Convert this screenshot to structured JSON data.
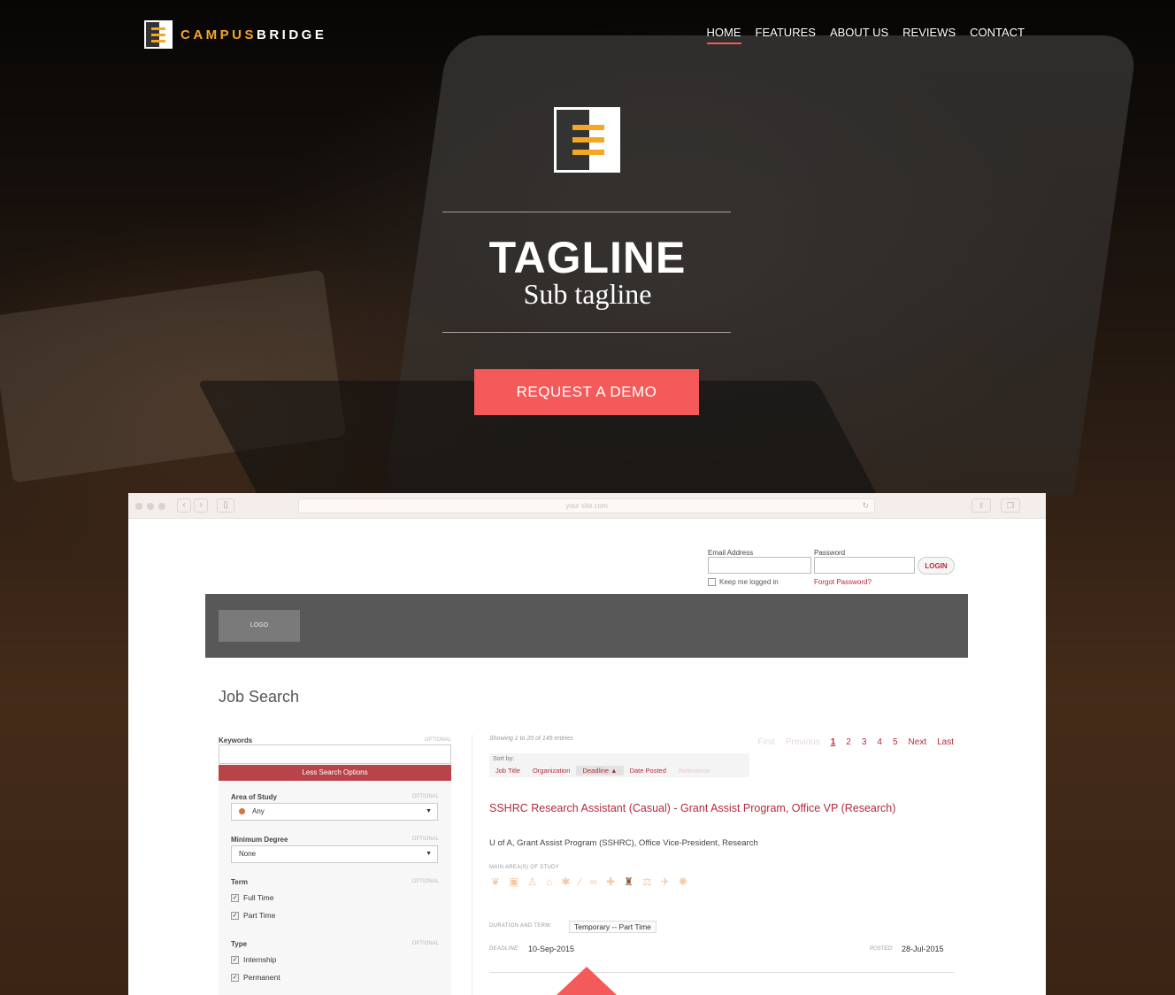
{
  "brand": {
    "campus": "CAMPUS",
    "bridge": "BRIDGE"
  },
  "nav": {
    "items": [
      {
        "label": "HOME",
        "active": true
      },
      {
        "label": "FEATURES"
      },
      {
        "label": "ABOUT US"
      },
      {
        "label": "REVIEWS"
      },
      {
        "label": "CONTACT"
      }
    ]
  },
  "hero": {
    "tagline": "TAGLINE",
    "subtagline": "Sub tagline",
    "cta": "REQUEST A DEMO"
  },
  "browser": {
    "url": "your site.com"
  },
  "mock": {
    "login": {
      "email_label": "Email Address",
      "password_label": "Password",
      "button": "LOGIN",
      "keep": "Keep me logged in",
      "forgot": "Forgot Password?"
    },
    "logo": "LOGO",
    "page_title": "Job Search",
    "search": {
      "keywords_label": "Keywords",
      "optional": "OPTIONAL",
      "less_options": "Less Search Options",
      "area_label": "Area of Study",
      "area_value": "Any",
      "degree_label": "Minimum Degree",
      "degree_value": "None",
      "term_label": "Term",
      "term_options": [
        "Full Time",
        "Part Time"
      ],
      "type_label": "Type",
      "type_options": [
        "Internship",
        "Permanent"
      ]
    },
    "results": {
      "showing": "Showing 1 to 20 of 145 entries",
      "pager": {
        "first": "First",
        "previous": "Previous",
        "pages": [
          "1",
          "2",
          "3",
          "4",
          "5"
        ],
        "next": "Next",
        "last": "Last"
      },
      "sort_by": "Sort by:",
      "sort_options": [
        "Job Title",
        "Organization",
        "Deadline ▲",
        "Date Posted",
        "Relevance"
      ],
      "title": "SSHRC Research Assistant (Casual) - Grant Assist Program, Office VP (Research)",
      "org": "U of A, Grant Assist Program (SSHRC), Office Vice-President, Research",
      "areas_label": "MAIN AREA(S) OF STUDY",
      "duration_label": "DURATION AND TERM:",
      "duration_value": "Temporary -- Part Time",
      "deadline_label": "DEADLINE:",
      "deadline_value": "10-Sep-2015",
      "posted_label": "POSTED:",
      "posted_value": "28-Jul-2015"
    }
  },
  "colors": {
    "accent": "#f55a5a",
    "brand_orange": "#f5a623",
    "link_red": "#b52a3a"
  }
}
